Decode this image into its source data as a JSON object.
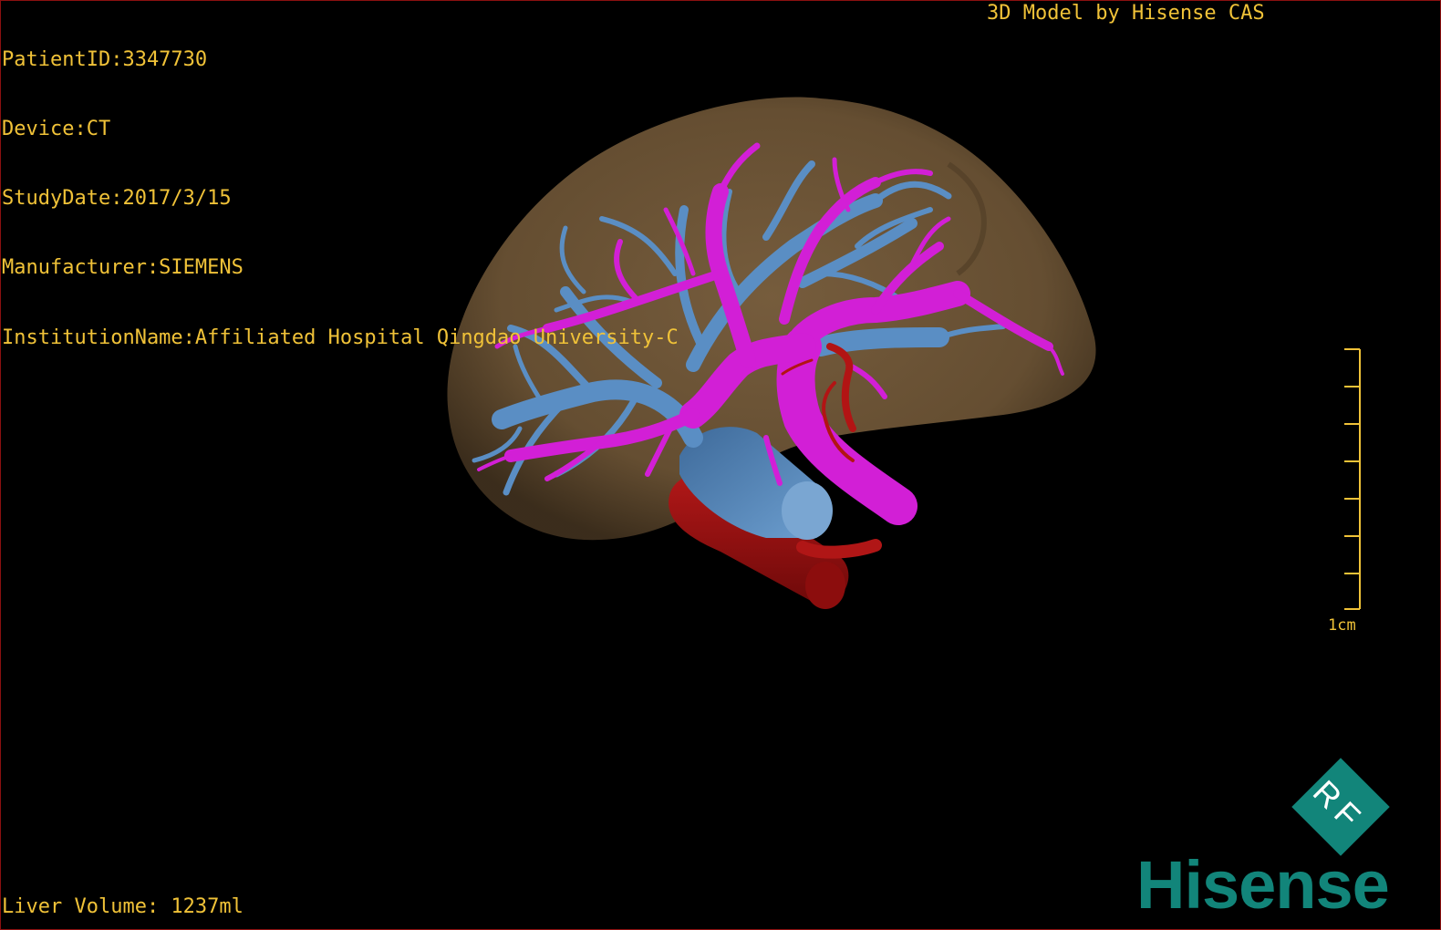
{
  "overlay": {
    "patient_id": "PatientID:3347730",
    "device": "Device:CT",
    "study_date": "StudyDate:2017/3/15",
    "manufacturer": "Manufacturer:SIEMENS",
    "institution": "InstitutionName:Affiliated Hospital Qingdao University-C",
    "brand_caption": "3D Model by Hisense CAS",
    "liver_volume": "Liver Volume: 1237ml"
  },
  "scale_bar": {
    "label": "1cm",
    "ticks": 8
  },
  "logo": {
    "badge_text": "RF",
    "wordmark": "Hisense",
    "color": "#12857a"
  },
  "colors": {
    "text": "#f0c238",
    "liver": "#6f5635",
    "hepatic_vein": "#5a8ec4",
    "portal_vein": "#d21fd6",
    "artery": "#a51414"
  }
}
